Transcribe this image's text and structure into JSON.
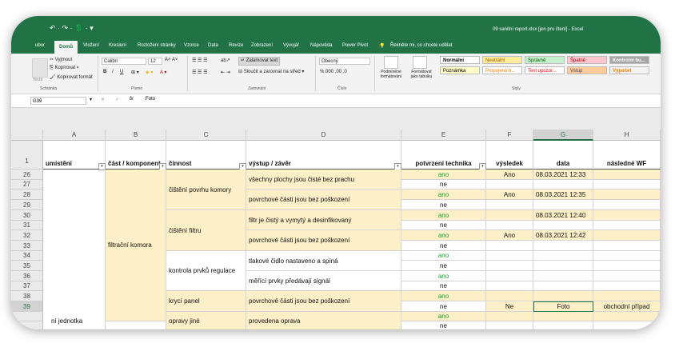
{
  "title_bar": {
    "quick_access": "↶ · ↷ · 💲 · ▾",
    "document_title": "09 sanitní report.xlsx  [jen pro čtení]  -  Excel"
  },
  "ribbon_tabs": [
    "ubor",
    "Domů",
    "Vložení",
    "Kreslení",
    "Rozložení stránky",
    "Vzorce",
    "Data",
    "Revize",
    "Zobrazení",
    "Vývojář",
    "Nápověda",
    "Power Pivot"
  ],
  "tell_me": "Řekněte mi, co chcete udělat",
  "ribbon": {
    "clipboard": {
      "paste": "Vložit",
      "cut": "Vyjmout",
      "copy": "Kopírovat",
      "format_painter": "Kopírovat formát",
      "group": "Schránka"
    },
    "font": {
      "name": "Calibri",
      "size": "12",
      "bold": "B",
      "italic": "I",
      "underline": "U",
      "group": "Písmo"
    },
    "alignment": {
      "wrap": "Zalamovat text",
      "merge": "Sloučit a zarovnat na střed",
      "group": "Zarovnání"
    },
    "number": {
      "format": "Obecný",
      "symbols": "% 000 ,00 ,0",
      "group": "Číslo"
    },
    "styles": {
      "conditional": "Podmíněné formátování",
      "as_table": "Formátovat jako tabulku",
      "group": "Styly",
      "cells": [
        {
          "label": "Normální",
          "bg": "#ffffff",
          "color": "#000000"
        },
        {
          "label": "Neutrální",
          "bg": "#ffeb9c",
          "color": "#9c5700"
        },
        {
          "label": "Správně",
          "bg": "#c6efce",
          "color": "#006100"
        },
        {
          "label": "Špatně",
          "bg": "#ffc7ce",
          "color": "#9c0006"
        },
        {
          "label": "Kontrolní bu...",
          "bg": "#a5a5a5",
          "color": "#ffffff"
        },
        {
          "label": "Poznámka",
          "bg": "#ffffcc",
          "color": "#000000"
        },
        {
          "label": "Propojená b...",
          "bg": "#ffffff",
          "color": "#fa7d00"
        },
        {
          "label": "Text upozor...",
          "bg": "#ffffff",
          "color": "#ff0000"
        },
        {
          "label": "Vstup",
          "bg": "#ffcc99",
          "color": "#3f3f76"
        },
        {
          "label": "Výpočet",
          "bg": "#f2f2f2",
          "color": "#fa7d00"
        }
      ]
    }
  },
  "formula_bar": {
    "name_box": "G39",
    "cancel": "✕",
    "enter": "✓",
    "fx": "fx",
    "value": "Foto"
  },
  "sheet": {
    "col_letters": [
      "A",
      "B",
      "C",
      "D",
      "E",
      "F",
      "G",
      "H"
    ],
    "header_row_num": "1",
    "headers": [
      "umístění",
      "část / komponent",
      "činnost",
      "výstup / závěr",
      "potvrzení technika",
      "výsledek",
      "data",
      "následné WF"
    ],
    "row_numbers": [
      "26",
      "27",
      "28",
      "29",
      "30",
      "31",
      "32",
      "33",
      "34",
      "35",
      "36",
      "37",
      "38",
      "39"
    ],
    "component": "filtrační komora",
    "activities": [
      "čištění povrhu komory",
      "čištění filtru",
      "kontrola prvků regulace",
      "krycí panel",
      "opravy jiné"
    ],
    "outputs": [
      "všechny plochy jsou čisté bez prachu",
      "povrchové části jsou bez poškození",
      "filtr je čistý a vymytý a desinfikovaný",
      "povrchové části jsou bez poškození",
      "tlakové čidlo nastaveno a spíná",
      "měřící prvky předávají signál",
      "povrchové části jsou bez poškození",
      "provedena oprava"
    ],
    "yes": "ano",
    "no": "ne",
    "results": {
      "r26": "Ano",
      "r28": "Ano",
      "r32": "Ano",
      "r39": "Ne"
    },
    "dates": {
      "r26": "08.03.2021 12:33",
      "r28": "08.03.2021 12:35",
      "r30": "08.03.2021 12:40",
      "r32": "08.03.2021 12:42",
      "r39": "Foto"
    },
    "followup": "obchodní případ",
    "next_location": "ní jednotka"
  }
}
